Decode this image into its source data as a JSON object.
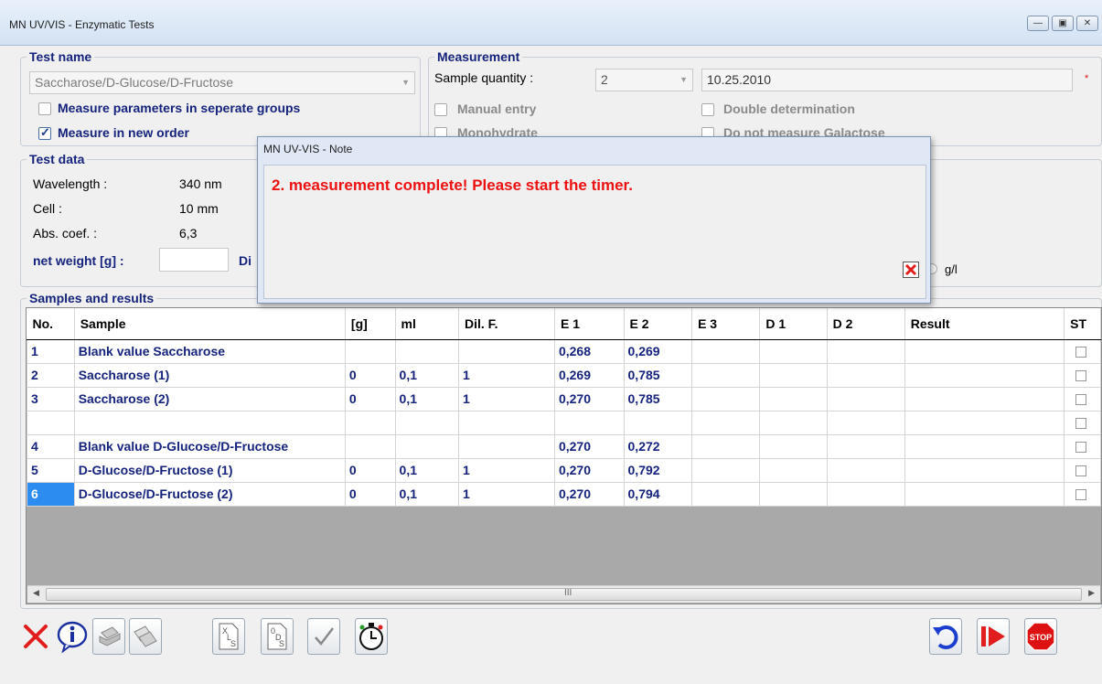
{
  "window": {
    "title": "MN UV/VIS - Enzymatic Tests"
  },
  "test_name": {
    "group_title": "Test name",
    "selected": "Saccharose/D-Glucose/D-Fructose",
    "separate_groups_label": "Measure parameters in seperate groups",
    "separate_groups_checked": false,
    "new_order_label": "Measure in new order",
    "new_order_checked": true
  },
  "measurement": {
    "group_title": "Measurement",
    "sample_quantity_label": "Sample quantity :",
    "sample_quantity": "2",
    "date": "10.25.2010",
    "required_marker": "*",
    "manual_entry_label": "Manual entry",
    "monohydrate_label": "Monohydrate",
    "double_determination_label": "Double determination",
    "no_galactose_label": "Do not measure Galactose"
  },
  "test_data": {
    "group_title": "Test data",
    "wavelength_label": "Wavelength :",
    "wavelength_value": "340 nm",
    "cell_label": "Cell :",
    "cell_value": "10 mm",
    "abs_coef_label": "Abs. coef. :",
    "abs_coef_value": "6,3",
    "net_weight_label": "net weight [g] :",
    "net_weight_value": "",
    "dilution_label_partial": "Di",
    "unit_label": "g/l"
  },
  "note_dialog": {
    "title": "MN UV-VIS - Note",
    "message": "2.  measurement complete! Please start the timer."
  },
  "samples": {
    "group_title": "Samples and results",
    "columns": [
      "No.",
      "Sample",
      "[g]",
      "ml",
      "Dil. F.",
      "E 1",
      "E 2",
      "E 3",
      "D 1",
      "D 2",
      "Result",
      "ST"
    ],
    "rows": [
      [
        "1",
        "Blank value Saccharose",
        "",
        "",
        "",
        "0,268",
        "0,269",
        "",
        "",
        "",
        ""
      ],
      [
        "2",
        "Saccharose (1)",
        "0",
        "0,1",
        "1",
        "0,269",
        "0,785",
        "",
        "",
        "",
        ""
      ],
      [
        "3",
        "Saccharose (2)",
        "0",
        "0,1",
        "1",
        "0,270",
        "0,785",
        "",
        "",
        "",
        ""
      ],
      [
        "",
        "",
        "",
        "",
        "",
        "",
        "",
        "",
        "",
        "",
        ""
      ],
      [
        "4",
        "Blank value D-Glucose/D-Fructose",
        "",
        "",
        "",
        "0,270",
        "0,272",
        "",
        "",
        "",
        ""
      ],
      [
        "5",
        "D-Glucose/D-Fructose (1)",
        "0",
        "0,1",
        "1",
        "0,270",
        "0,792",
        "",
        "",
        "",
        ""
      ],
      [
        "6",
        "D-Glucose/D-Fructose (2)",
        "0",
        "0,1",
        "1",
        "0,270",
        "0,794",
        "",
        "",
        "",
        ""
      ]
    ],
    "selected_row": 6,
    "scroll_grip": "III"
  },
  "toolbar": {
    "left": [
      "cancel-icon",
      "info-icon",
      "printer-icon",
      "copy-icon",
      "excel-export-icon",
      "ods-export-icon",
      "confirm-check-icon",
      "timer-icon"
    ],
    "right": [
      "undo-icon",
      "next-measurement-icon",
      "stop-icon"
    ]
  },
  "colors": {
    "label_navy": "#15237d",
    "alert_red": "#ee1111",
    "selection_blue": "#2d8cf0"
  }
}
